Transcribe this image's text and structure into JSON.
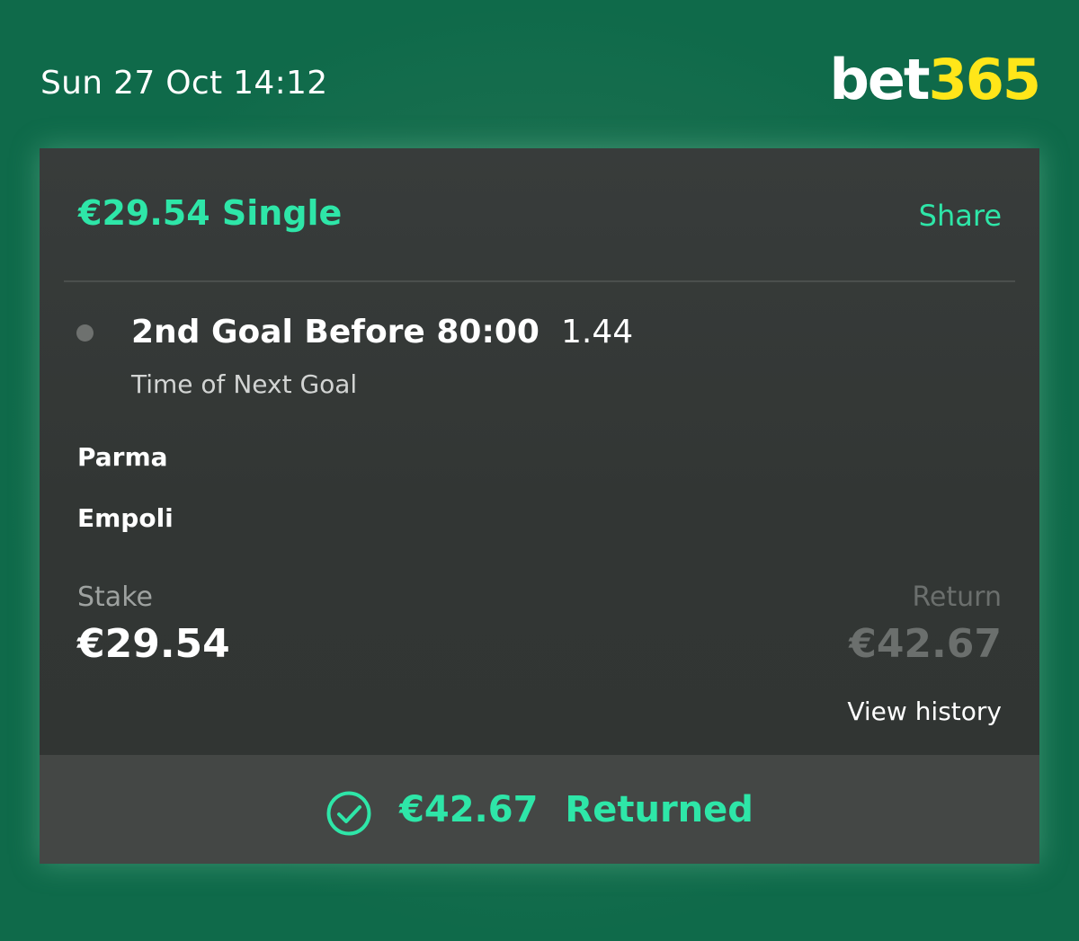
{
  "header": {
    "datetime": "Sun 27 Oct 14:12",
    "logo_left": "bet",
    "logo_right": "365"
  },
  "bet": {
    "title": "€29.54 Single",
    "share_label": "Share",
    "selection_name": "2nd Goal Before 80:00",
    "odds": "1.44",
    "market": "Time of Next Goal",
    "team_home": "Parma",
    "team_away": "Empoli",
    "stake_label": "Stake",
    "stake_value": "€29.54",
    "return_label": "Return",
    "return_value": "€42.67",
    "history_label": "View history"
  },
  "footer": {
    "amount": "€42.67",
    "status": "Returned",
    "icon": "check-circle-icon"
  },
  "colors": {
    "accent": "#2ee6a8",
    "logo_yellow": "#ffe619",
    "background": "#0f6a4a",
    "card": "#343836",
    "footer": "#444745"
  }
}
